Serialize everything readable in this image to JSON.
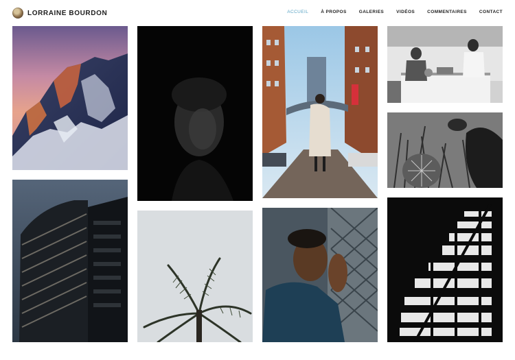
{
  "site": {
    "brand_name": "LORRAINE BOURDON"
  },
  "nav": {
    "items": [
      {
        "label": "ACCUEIL",
        "active": true
      },
      {
        "label": "À PROPOS",
        "active": false
      },
      {
        "label": "GALERIES",
        "active": false
      },
      {
        "label": "VIDÉOS",
        "active": false
      },
      {
        "label": "COMMENTAIRES",
        "active": false
      },
      {
        "label": "CONTACT",
        "active": false
      }
    ]
  },
  "colors": {
    "accent": "#5aa3c4",
    "background": "#ffffff",
    "text": "#222222"
  },
  "gallery": {
    "photos": [
      {
        "name": "mountain-sunset"
      },
      {
        "name": "dark-portrait"
      },
      {
        "name": "woman-under-bridge"
      },
      {
        "name": "kitchen-couple"
      },
      {
        "name": "cactus-garden"
      },
      {
        "name": "modern-building"
      },
      {
        "name": "palm-tree"
      },
      {
        "name": "man-at-wall"
      },
      {
        "name": "dark-window"
      }
    ]
  }
}
